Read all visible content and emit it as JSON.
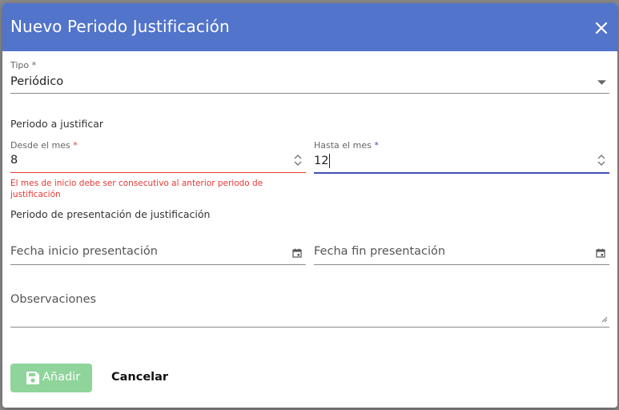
{
  "dialog": {
    "title": "Nuevo Periodo Justificación"
  },
  "form": {
    "tipo": {
      "label": "Tipo",
      "required_mark": "*",
      "value": "Periódico"
    },
    "periodo_section": "Periodo a justificar",
    "desde": {
      "label": "Desde el mes",
      "required_mark": "*",
      "value": "8",
      "error": "El mes de inicio debe ser consecutivo al anterior periodo de justificación"
    },
    "hasta": {
      "label": "Hasta el mes",
      "required_mark": "*",
      "value": "12"
    },
    "presentacion_section": "Periodo de presentación de justificación",
    "fecha_inicio": {
      "placeholder": "Fecha inicio presentación"
    },
    "fecha_fin": {
      "placeholder": "Fecha fin presentación"
    },
    "observaciones": {
      "placeholder": "Observaciones"
    }
  },
  "actions": {
    "add_label": "Añadir",
    "cancel_label": "Cancelar"
  },
  "colors": {
    "header": "#5274cb",
    "error": "#e53935",
    "focus": "#3f51b5",
    "add_button_disabled": "#8fd49a"
  }
}
